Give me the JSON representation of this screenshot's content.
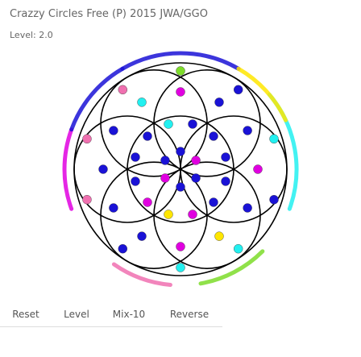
{
  "header": {
    "title": "Crazzy Circles Free (P) 2015 JWA/GGO",
    "level": "Level: 2.0"
  },
  "buttons": [
    {
      "label": "Reset"
    },
    {
      "label": "Level"
    },
    {
      "label": "Mix-10"
    },
    {
      "label": "Reverse"
    }
  ],
  "colors": {
    "blue": "#1a12d6",
    "yellow": "#ffe600",
    "magenta": "#e000e0",
    "cyan": "#22f0f0",
    "pink": "#f070b0",
    "green": "#7ddc2a",
    "line": "#000000"
  },
  "game": {
    "rings": [
      {
        "color": "magenta"
      },
      {
        "color": "blue"
      },
      {
        "color": "cyan"
      },
      {
        "color": "pink"
      },
      {
        "color": "green"
      },
      {
        "color": "blue"
      },
      {
        "color": "yellow"
      }
    ],
    "dots": [
      "blue",
      "blue",
      "magenta",
      "blue",
      "blue",
      "magenta",
      "blue",
      "blue",
      "magenta",
      "yellow",
      "magenta",
      "blue",
      "blue",
      "blue",
      "cyan",
      "blue",
      "blue",
      "blue",
      "magenta",
      "blue",
      "yellow",
      "magenta",
      "blue",
      "blue",
      "blue",
      "blue",
      "cyan",
      "magenta",
      "blue",
      "blue",
      "blue",
      "cyan",
      "cyan",
      "blue",
      "pink",
      "pink",
      "pink",
      "green",
      "blue",
      "cyan"
    ]
  }
}
